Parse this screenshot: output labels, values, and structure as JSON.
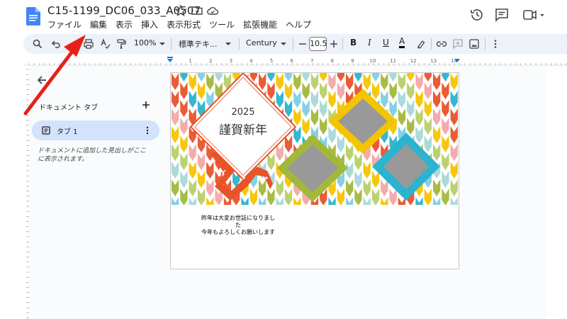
{
  "document": {
    "title": "C15-1199_DC06_033_A0507"
  },
  "menu": [
    "ファイル",
    "編集",
    "表示",
    "挿入",
    "表示形式",
    "ツール",
    "拡張機能",
    "ヘルプ"
  ],
  "toolbar": {
    "zoom": "100%",
    "style": "標準テキ...",
    "font": "Century",
    "font_size": "10.5",
    "bold": "B",
    "italic": "I",
    "underline": "U",
    "text_color": "A"
  },
  "ruler": {
    "ticks": [
      "1",
      "2",
      "3",
      "4",
      "5",
      "6",
      "7",
      "8",
      "9",
      "10",
      "11",
      "12",
      "13",
      "14"
    ]
  },
  "sidebar": {
    "title": "ドキュメント タブ",
    "tab_label": "タブ 1",
    "hint": "ドキュメントに追加した見出しがここに表示されます。"
  },
  "card": {
    "year": "2025",
    "greeting": "謹賀新年",
    "message_lines": [
      "昨年は大変お世話になりまし",
      "た",
      "今年もよろしくお願いします"
    ]
  },
  "colors": {
    "accent": "#1a73e8",
    "doc_icon": "#4285f4",
    "annotation_arrow": "#e8201a"
  },
  "icons": [
    "google-docs-icon",
    "star-icon",
    "move-to-folder-icon",
    "cloud-saved-icon",
    "history-icon",
    "comments-icon",
    "video-call-icon"
  ]
}
